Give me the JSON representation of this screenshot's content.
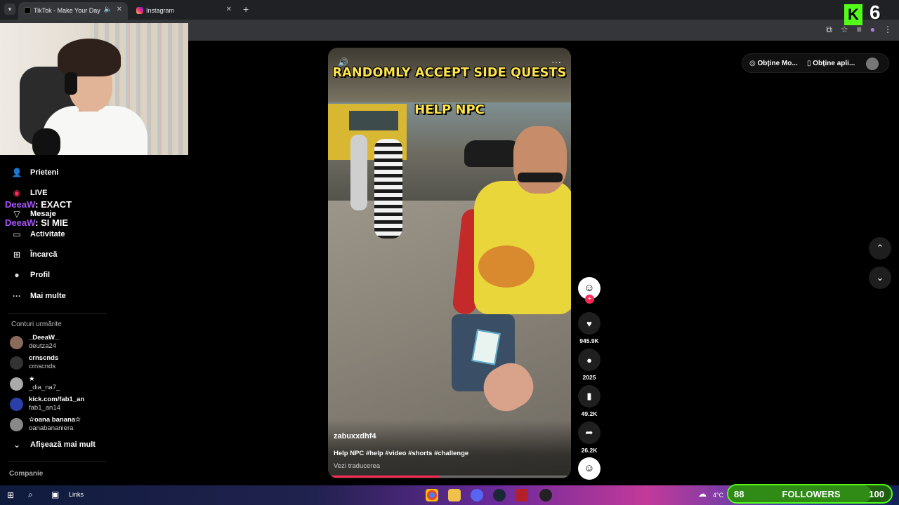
{
  "browser": {
    "tabs": [
      {
        "title": "TikTok - Make Your Day",
        "active": true
      },
      {
        "title": "Instagram",
        "active": false
      }
    ],
    "new_tab_label": "+"
  },
  "tiktok_header": {
    "get_coins_label": "Obține Mo...",
    "get_app_label": "Obține apli..."
  },
  "sidebar": {
    "items": [
      {
        "label": "Prieteni",
        "icon": "friends-icon"
      },
      {
        "label": "LIVE",
        "icon": "live-icon"
      },
      {
        "label": "Mesaje",
        "icon": "messages-icon"
      },
      {
        "label": "Activitate",
        "icon": "activity-icon"
      },
      {
        "label": "Încarcă",
        "icon": "upload-icon"
      },
      {
        "label": "Profil",
        "icon": "profile-icon"
      },
      {
        "label": "Mai multe",
        "icon": "more-icon"
      }
    ],
    "following_heading": "Conturi urmărite",
    "following": [
      {
        "display": "_DeeaW_",
        "handle": "deutza24"
      },
      {
        "display": "crnscnds",
        "handle": "crnscnds"
      },
      {
        "display": "★",
        "handle": "_dia_na7_"
      },
      {
        "display": "kick.com/fab1_an",
        "handle": "fab1_an14"
      },
      {
        "display": "✫oana banana✫",
        "handle": "oanabananiera"
      }
    ],
    "show_more_label": "Afișează mai mult",
    "company_label": "Companie"
  },
  "chat": [
    {
      "user": "DeeaW",
      "message": ": EXACT"
    },
    {
      "user": "DeeaW",
      "message": ": SI MIE"
    }
  ],
  "video": {
    "overlay_title": "RANDOMLY ACCEPT SIDE QUESTS",
    "overlay_subtitle": "HELP NPC",
    "author": "zabuxxdhf4",
    "caption": "Help NPC #help #video #shorts #challenge",
    "translate_label": "Vezi traducerea",
    "progress_fraction": 0.46
  },
  "actions": {
    "likes": "945.9K",
    "comments": "2025",
    "saves": "49.2K",
    "shares": "26.2K"
  },
  "kick": {
    "logo_letter": "K",
    "number": "6"
  },
  "taskbar": {
    "links_label": "Links",
    "temperature": "4°C"
  },
  "followers_goal": {
    "current": "88",
    "label": "FOLLOWERS",
    "goal": "100",
    "progress_fraction": 0.88
  }
}
